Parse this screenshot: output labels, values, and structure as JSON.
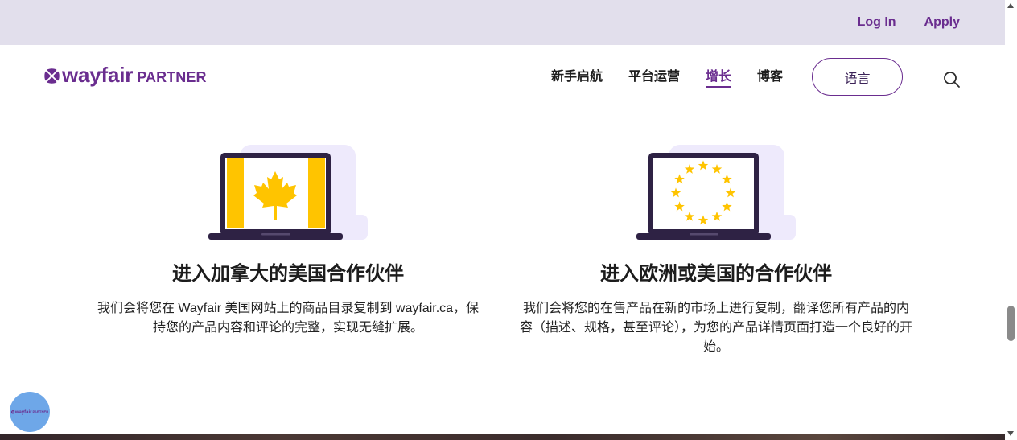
{
  "top_bar": {
    "login_label": "Log In",
    "apply_label": "Apply"
  },
  "header": {
    "logo": {
      "icon": "wayfair-logo-icon",
      "wordmark": "wayfair",
      "suffix": "PARTNER"
    },
    "nav": [
      {
        "label": "新手启航",
        "active": false
      },
      {
        "label": "平台运营",
        "active": false
      },
      {
        "label": "增长",
        "active": true
      },
      {
        "label": "博客",
        "active": false
      }
    ],
    "language_button_label": "语言",
    "search_icon": "search-icon"
  },
  "features": [
    {
      "icon": "canada-flag-laptop-icon",
      "title": "进入加拿大的美国合作伙伴",
      "description": "我们会将您在 Wayfair 美国网站上的商品目录复制到 wayfair.ca，保持您的产品内容和评论的完整，实现无缝扩展。"
    },
    {
      "icon": "eu-flag-laptop-icon",
      "title": "进入欧洲或美国的合作伙伴",
      "description": "我们会将您的在售产品在新的市场上进行复制，翻译您所有产品的内容（描述、规格，甚至评论），为您的产品详情页面打造一个良好的开始。"
    }
  ],
  "floating_widget": {
    "icon": "wayfair-logo-icon",
    "wordmark": "wayfair",
    "suffix": "PARTNER"
  },
  "colors": {
    "brand_purple": "#6a2d8f",
    "top_bar_bg": "#e2dfec",
    "illustration_lavender": "#eeeafc",
    "flag_yellow": "#ffc400",
    "laptop_frame": "#2e2244",
    "widget_blue": "#6ea7e8"
  }
}
